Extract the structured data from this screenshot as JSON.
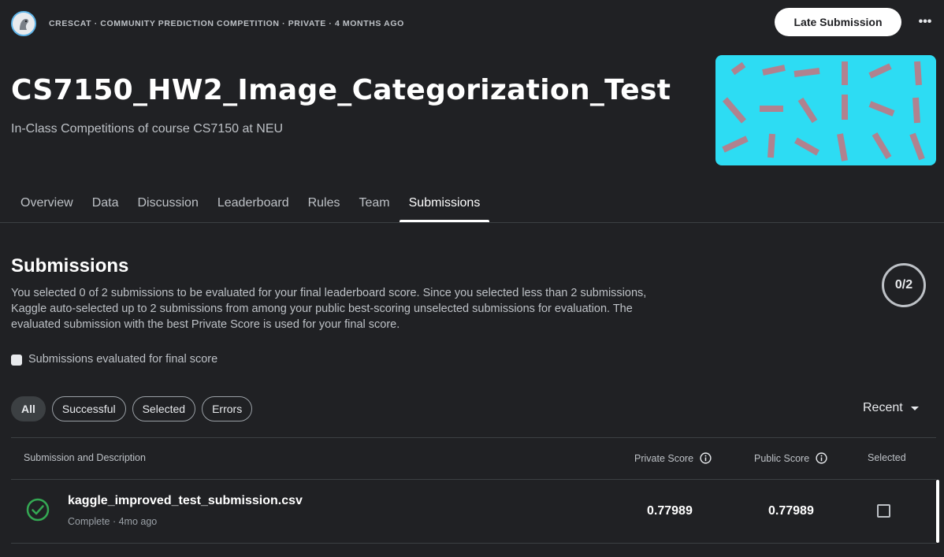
{
  "header": {
    "breadcrumb": "CRESCAT · COMMUNITY PREDICTION COMPETITION · PRIVATE · 4 MONTHS AGO",
    "late_submission_label": "Late Submission",
    "more_label": "•••"
  },
  "competition": {
    "title": "CS7150_HW2_Image_Categorization_Test",
    "subtitle": "In-Class Competitions of course CS7150 at NEU",
    "banner_color": "#2ddcf3"
  },
  "tabs": [
    {
      "label": "Overview"
    },
    {
      "label": "Data"
    },
    {
      "label": "Discussion"
    },
    {
      "label": "Leaderboard"
    },
    {
      "label": "Rules"
    },
    {
      "label": "Team"
    },
    {
      "label": "Submissions",
      "active": true
    }
  ],
  "submissions": {
    "title": "Submissions",
    "description": "You selected 0 of 2 submissions to be evaluated for your final leaderboard score. Since you selected less than 2 submissions, Kaggle auto-selected up to 2 submissions from among your public best-scoring unselected submissions for evaluation. The evaluated submission with the best Private Score is used for your final score.",
    "counter": "0/2",
    "evaluated_filter_label": "Submissions evaluated for final score",
    "filters": [
      "All",
      "Successful",
      "Selected",
      "Errors"
    ],
    "active_filter": "All",
    "sort_label": "Recent",
    "columns": {
      "description": "Submission and Description",
      "private": "Private Score",
      "public": "Public Score",
      "selected": "Selected"
    },
    "rows": [
      {
        "file": "kaggle_improved_test_submission.csv",
        "meta": "Complete · 4mo ago",
        "status_icon": "check-circle-icon",
        "private_score": "0.77989",
        "public_score": "0.77989",
        "selected": false
      }
    ]
  },
  "colors": {
    "background": "#202124",
    "success": "#34a853",
    "banner": "#2ddcf3",
    "banner_marks": "#b0828f"
  }
}
